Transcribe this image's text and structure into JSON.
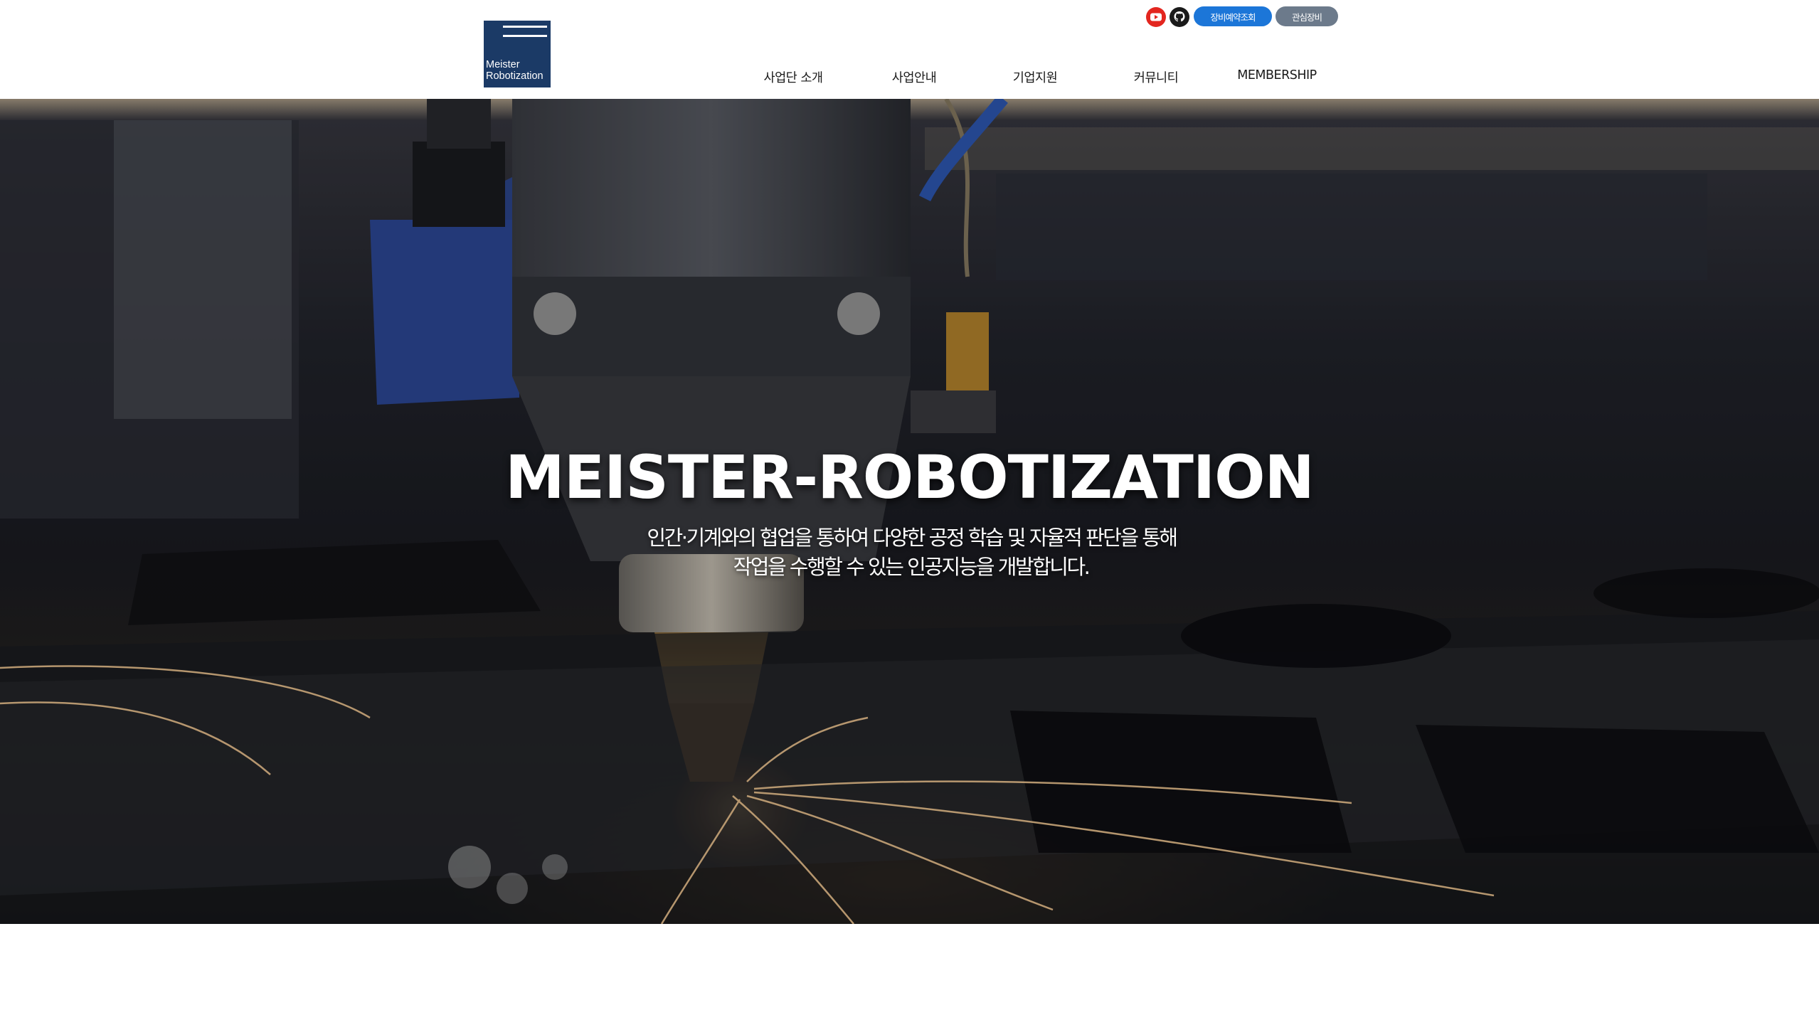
{
  "logo": {
    "line1": "Meister",
    "line2": "Robotization",
    "color": "#1b3a66"
  },
  "top_links": {
    "youtube_icon": "youtube-icon",
    "github_icon": "github-icon",
    "reserve_label": "장비예약조회",
    "interest_label": "관심장비",
    "reserve_color": "#1c76d8",
    "interest_color": "#6c7a8b"
  },
  "nav": {
    "items": [
      {
        "label": "사업단 소개"
      },
      {
        "label": "사업안내"
      },
      {
        "label": "기업지원"
      },
      {
        "label": "커뮤니티"
      },
      {
        "label": "MEMBERSHIP"
      }
    ]
  },
  "hero": {
    "title": "MEISTER-ROBOTIZATION",
    "subtitle_line1": "인간·기계와의 협업을 통하여 다양한 공정 학습 및 자율적 판단을 통해",
    "subtitle_line2": "작업을 수행할 수 있는 인공지능을 개발합니다."
  }
}
